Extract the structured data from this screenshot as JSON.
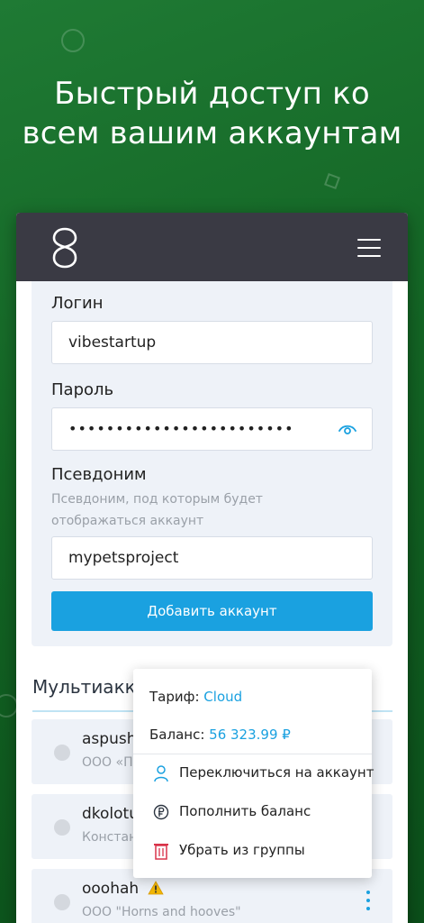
{
  "headline": {
    "line1": "Быстрый доступ ко",
    "line2": "всем вашим аккаунтам"
  },
  "appbar": {
    "logo_icon": "logo-icon",
    "menu_icon": "hamburger-menu-icon",
    "bg_color": "#3a3a44"
  },
  "form": {
    "login_label": "Логин",
    "login_value": "vibestartup",
    "password_label": "Пароль",
    "password_value": "••••••••••••••••••••••••",
    "alias_label": "Псевдоним",
    "alias_hint_line1": "Псевдоним, под которым будет",
    "alias_hint_line2": "отображаться аккаунт",
    "alias_value": "mypetsproject",
    "add_button": "Добавить аккаунт"
  },
  "multiaccount": {
    "title": "Мультиаккаунт",
    "accounts": [
      {
        "name": "aspush",
        "sub": "ООО «П"
      },
      {
        "name": "dkolotu",
        "sub": "Констан"
      },
      {
        "name": "ooohah",
        "sub": "ООО \"Horns and hooves\""
      }
    ]
  },
  "popup": {
    "tariff_label": "Тариф:",
    "tariff_value": "Cloud",
    "balance_label": "Баланс:",
    "balance_value": "56 323.99 ₽",
    "items": [
      {
        "label": "Переключиться на аккаунт",
        "icon": "user-icon"
      },
      {
        "label": "Пополнить баланс",
        "icon": "ruble-coin-icon"
      },
      {
        "label": "Убрать из группы",
        "icon": "trash-icon"
      }
    ]
  },
  "colors": {
    "accent": "#1aa1e0",
    "background_green": "#136424",
    "danger": "#d9334a",
    "warning": "#f2b705"
  }
}
